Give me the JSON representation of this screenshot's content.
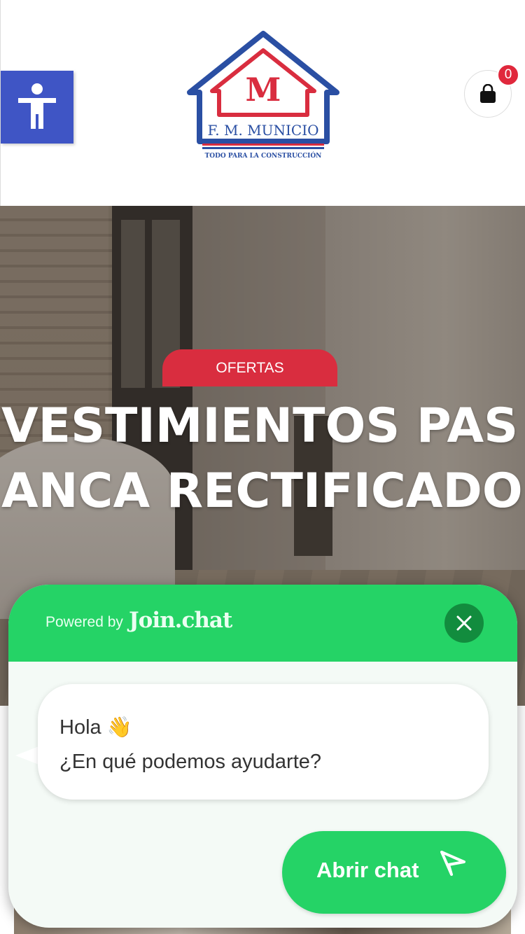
{
  "header": {
    "logo_name": "F. M. MUNICIO",
    "logo_letter": "M",
    "logo_tagline": "TODO PARA LA CONSTRUCCIÓN",
    "cart_count": "0",
    "icons": {
      "accessibility": "accessibility-person-icon",
      "cart": "shopping-bag-icon"
    }
  },
  "hero": {
    "badge": "OFERTAS",
    "title_line1": "VESTIMIENTOS PAS",
    "title_line2": "ANCA RECTIFICADO"
  },
  "chat_widget": {
    "powered_by": "Powered by",
    "brand": "Join.chat",
    "greeting_line1": "Hola",
    "greeting_emoji": "👋",
    "greeting_line2": "¿En qué podemos ayudarte?",
    "open_button": "Abrir chat",
    "colors": {
      "primary": "#25d366",
      "close_bg": "#128c3e"
    },
    "icons": {
      "close": "close-icon",
      "send": "send-icon"
    }
  },
  "colors": {
    "accessibility_bg": "#3f55c5",
    "badge_red": "#d92d3f",
    "logo_blue": "#2a4fa3",
    "logo_red": "#d92d3f"
  }
}
